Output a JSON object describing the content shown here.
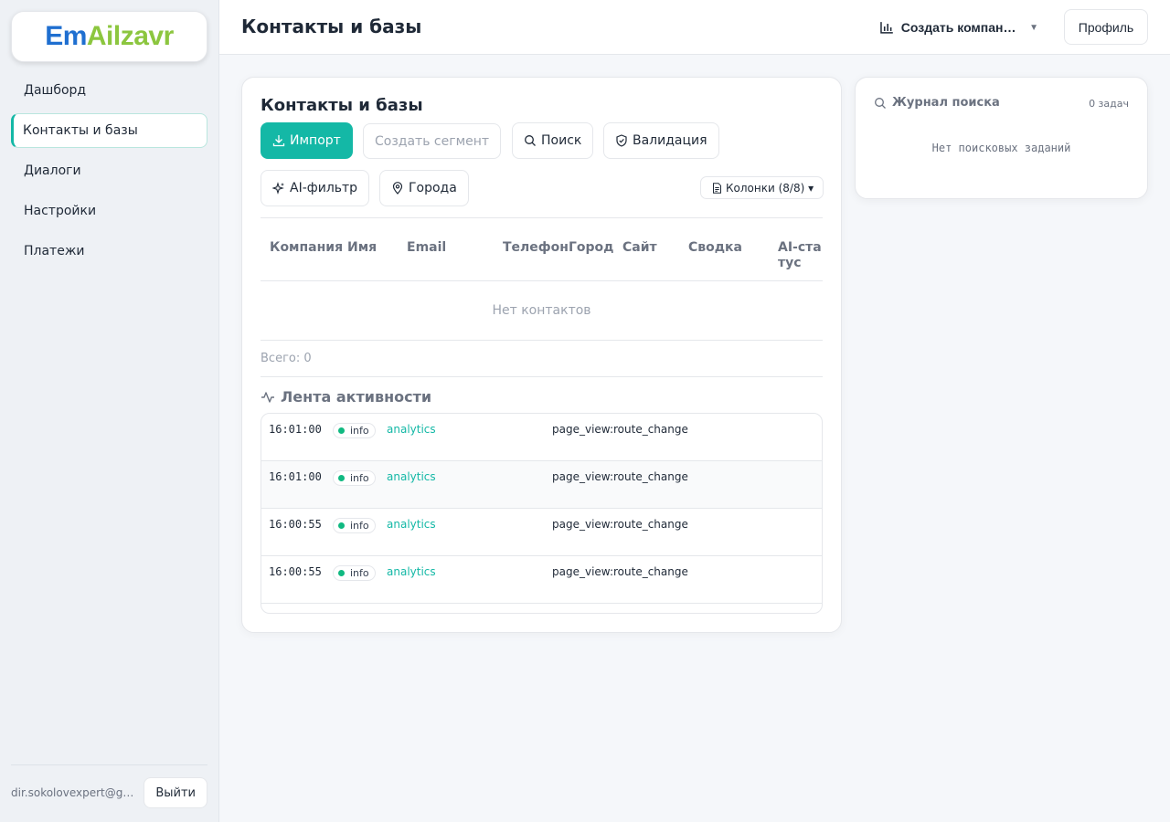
{
  "logo": {
    "part1": "Em",
    "part2": "Ai",
    "part3": "l",
    "part4": "zavr"
  },
  "sidebar": {
    "items": [
      {
        "label": "Дашборд"
      },
      {
        "label": "Контакты и базы"
      },
      {
        "label": "Диалоги"
      },
      {
        "label": "Настройки"
      },
      {
        "label": "Платежи"
      }
    ],
    "active_index": 1,
    "user_email": "dir.sokolovexpert@gmail.com",
    "logout_label": "Выйти"
  },
  "topbar": {
    "title": "Контакты и базы",
    "campaign_label": "Создать компанию",
    "profile_label": "Профиль"
  },
  "main": {
    "title": "Контакты и базы",
    "buttons": {
      "import": "Импорт",
      "create_segment": "Создать сегмент",
      "search": "Поиск",
      "validation": "Валидация",
      "ai_filter": "AI-фильтр",
      "cities": "Города",
      "columns": "Колонки (8/8) ▾"
    },
    "table": {
      "columns": [
        "Компания",
        "Имя",
        "Email",
        "Телефон",
        "Город",
        "Сайт",
        "Сводка",
        "AI-статус"
      ],
      "empty_message": "Нет контактов",
      "total_label": "Всего: 0"
    },
    "activity": {
      "title": "Лента активности",
      "rows": [
        {
          "time": "16:01:00",
          "level": "info",
          "source": "analytics",
          "event": "page_view:route_change"
        },
        {
          "time": "16:01:00",
          "level": "info",
          "source": "analytics",
          "event": "page_view:route_change"
        },
        {
          "time": "16:00:55",
          "level": "info",
          "source": "analytics",
          "event": "page_view:route_change"
        },
        {
          "time": "16:00:55",
          "level": "info",
          "source": "analytics",
          "event": "page_view:route_change"
        }
      ]
    }
  },
  "search_log": {
    "title": "Журнал поиска",
    "count": "0 задач",
    "empty": "Нет поисковых заданий"
  },
  "colors": {
    "accent": "#14b8a6",
    "status_info": "#10b981",
    "logo_blue": "#1f6fd0",
    "logo_green": "#8cc63f"
  },
  "icons": {
    "campaign": "bar-chart-icon",
    "import": "download-icon",
    "search": "search-icon",
    "validation": "shield-icon",
    "ai_filter": "sparkles-icon",
    "cities": "map-pin-icon",
    "columns": "document-icon",
    "activity": "pulse-icon",
    "search_log": "search-icon"
  }
}
